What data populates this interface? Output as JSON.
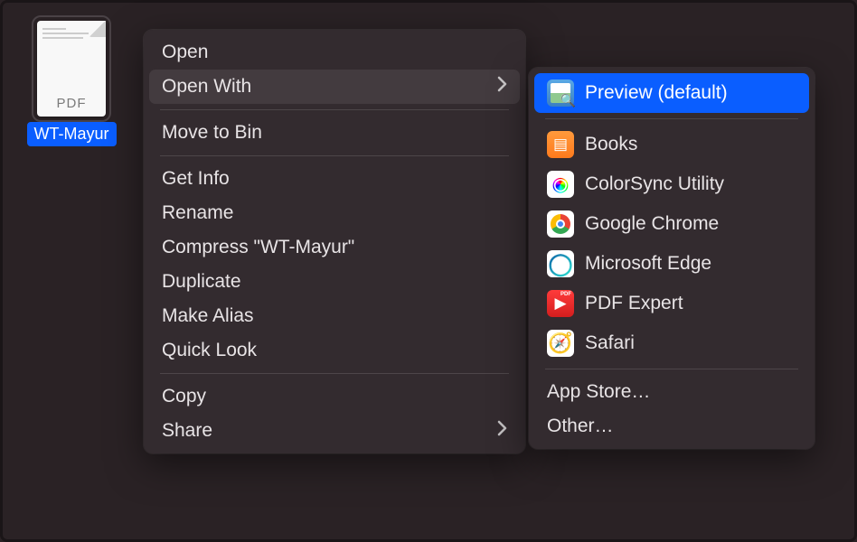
{
  "file": {
    "badge": "PDF",
    "name": "WT-Mayur"
  },
  "menu": {
    "open": "Open",
    "open_with": "Open With",
    "move_to_bin": "Move to Bin",
    "get_info": "Get Info",
    "rename": "Rename",
    "compress": "Compress \"WT-Mayur\"",
    "duplicate": "Duplicate",
    "make_alias": "Make Alias",
    "quick_look": "Quick Look",
    "copy": "Copy",
    "share": "Share"
  },
  "open_with": {
    "preview": "Preview (default)",
    "books": "Books",
    "colorsync": "ColorSync Utility",
    "chrome": "Google Chrome",
    "edge": "Microsoft Edge",
    "pdfexpert": "PDF Expert",
    "safari": "Safari",
    "app_store": "App Store…",
    "other": "Other…"
  }
}
